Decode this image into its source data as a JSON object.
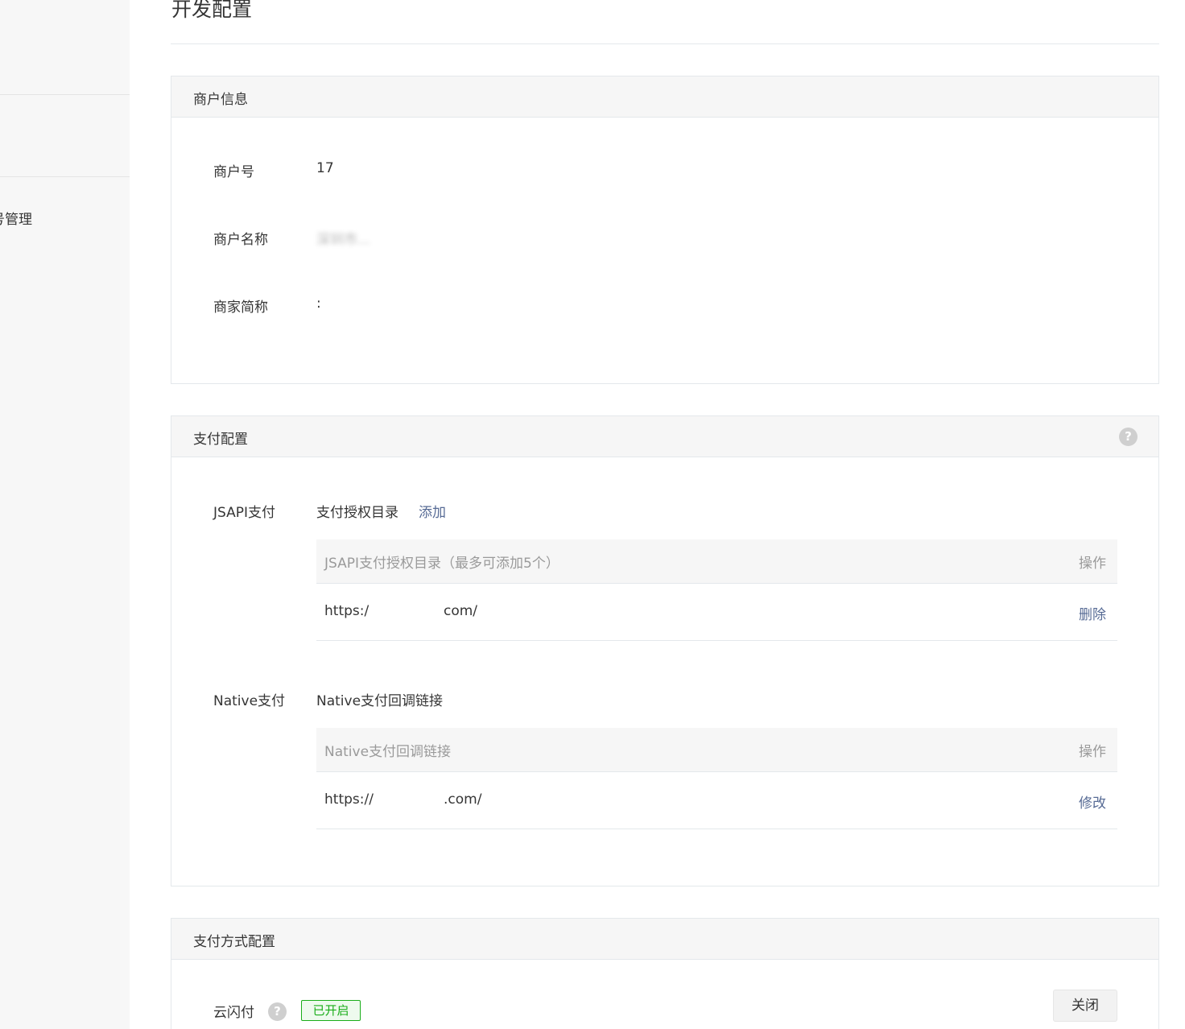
{
  "sidebar": {
    "item_partial": "号管理"
  },
  "page": {
    "title": "开发配置"
  },
  "merchant_info": {
    "title": "商户信息",
    "rows": [
      {
        "label": "商户号",
        "value": "17"
      },
      {
        "label": "商户名称",
        "value": "深圳市..."
      },
      {
        "label": "商家简称",
        "value": ":"
      }
    ]
  },
  "pay_config": {
    "title": "支付配置",
    "help_icon": "question-icon",
    "jsapi": {
      "label": "JSAPI支付",
      "sub_title": "支付授权目录",
      "add_link": "添加",
      "table": {
        "header_col": "JSAPI支付授权目录（最多可添加5个）",
        "header_op": "操作",
        "rows": [
          {
            "url_start": "https:/",
            "url_end": "com/",
            "op": "删除"
          }
        ]
      }
    },
    "native": {
      "label": "Native支付",
      "sub_title": "Native支付回调链接",
      "table": {
        "header_col": "Native支付回调链接",
        "header_op": "操作",
        "rows": [
          {
            "url_start": "https://",
            "url_end": ".com/",
            "op": "修改"
          }
        ]
      }
    }
  },
  "pay_method": {
    "title": "支付方式配置",
    "item": {
      "label": "云闪付",
      "help_icon": "question-icon",
      "status": "已开启",
      "button": "关闭"
    }
  },
  "colors": {
    "link": "#576b95",
    "success": "#1aad19",
    "panel_head_bg": "#f6f6f6",
    "border": "#e4e8eb"
  }
}
